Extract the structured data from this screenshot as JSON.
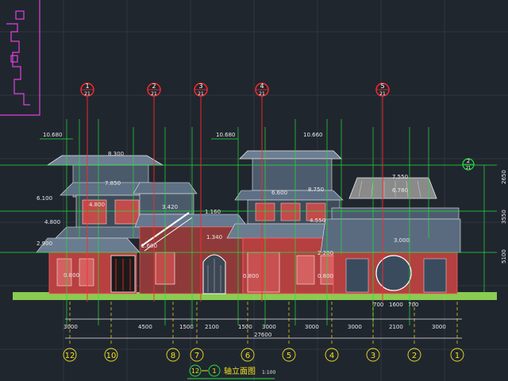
{
  "drawing": {
    "title": "①-⑫立面图",
    "title_start": "12",
    "title_end": "1",
    "title_text": "轴立面图",
    "scale": "1:100"
  },
  "elevations": {
    "left": [
      "10.680",
      "6.100",
      "4.800",
      "2.900",
      "0.800"
    ],
    "mid_left": [
      "8.300",
      "7.850",
      "4.800",
      "3.420",
      "2.600",
      "1.160",
      "1.340"
    ],
    "center": [
      "10.680",
      "6.600",
      "0.800"
    ],
    "mid_right": [
      "10.660",
      "8.750",
      "4.550",
      "2.200",
      "0.800"
    ],
    "right": [
      "7.550",
      "6.780",
      "3.000"
    ]
  },
  "side_dims": [
    "2650",
    "3550",
    "5100"
  ],
  "bottom_dims": [
    "3000",
    "4500",
    "1500",
    "2100",
    "1500",
    "3000",
    "3000",
    "3000",
    "2100",
    "3000"
  ],
  "gable_dims": [
    "700",
    "1600",
    "700"
  ],
  "total_dim": "27600",
  "axes": [
    "12",
    "10",
    "8",
    "7",
    "6",
    "5",
    "4",
    "3",
    "2",
    "1"
  ],
  "section_marks": [
    {
      "num": "1",
      "sub": "21"
    },
    {
      "num": "2",
      "sub": "21"
    },
    {
      "num": "3",
      "sub": "21"
    },
    {
      "num": "4",
      "sub": "21"
    },
    {
      "num": "5",
      "sub": "21"
    },
    {
      "num": "2",
      "sub": "21"
    }
  ],
  "colors": {
    "background": "#20262e",
    "roof": "#5a6b7f",
    "wall": "#c24b4b",
    "green": "#22e03a",
    "white": "#e9e9e9",
    "yellow": "#f0e020",
    "red": "#ff2a2a",
    "magenta": "#e040e0"
  }
}
